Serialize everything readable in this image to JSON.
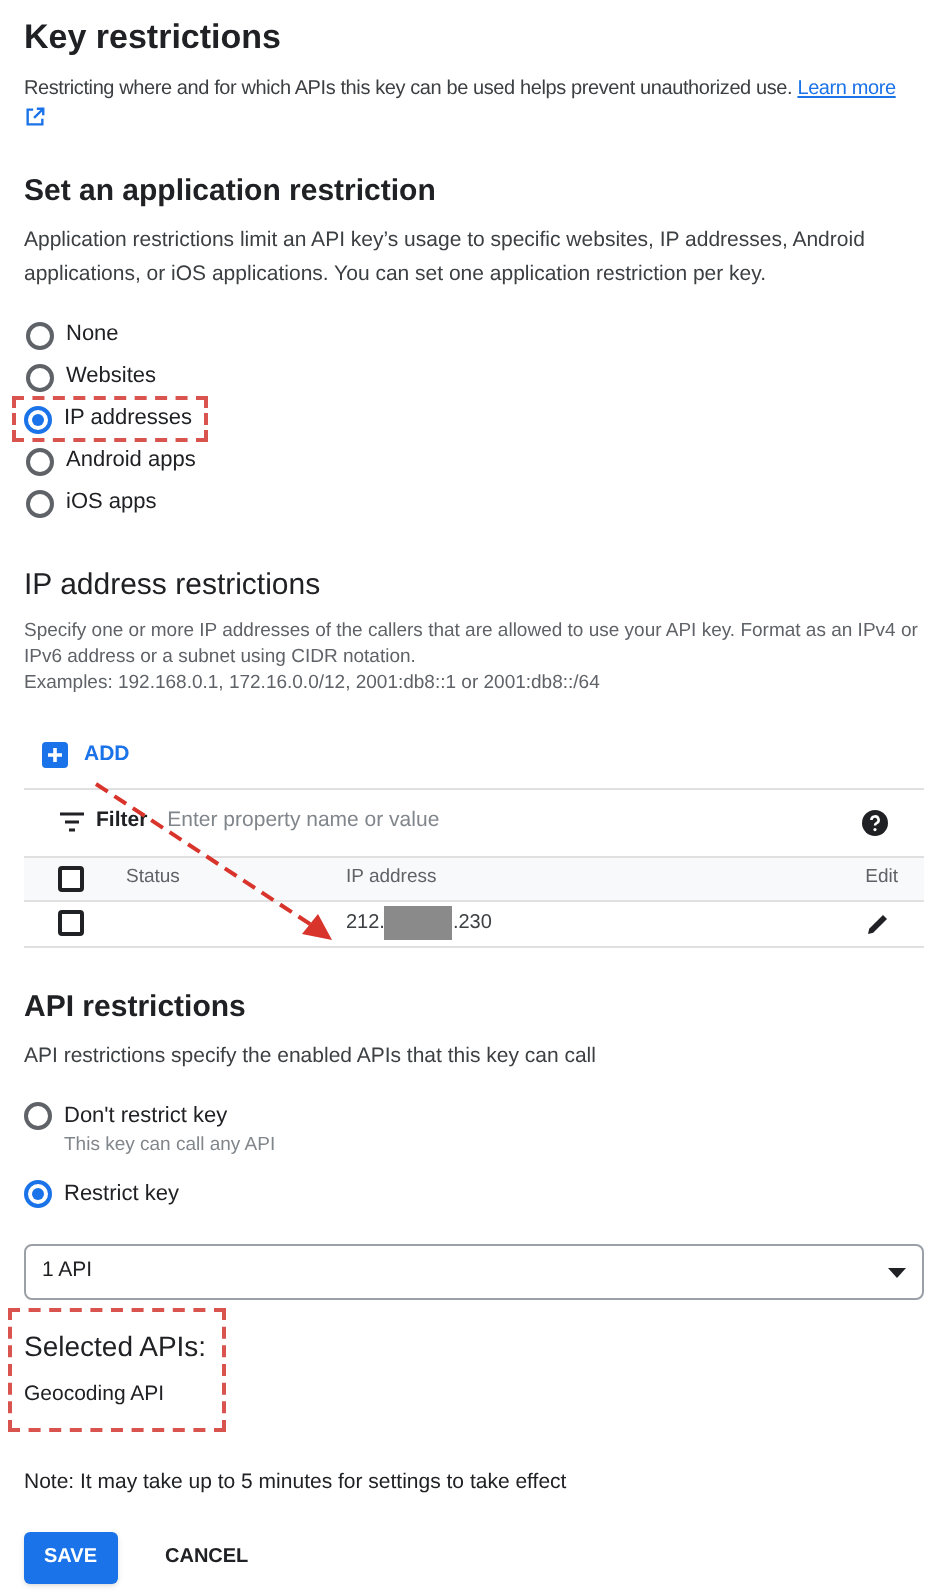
{
  "key_restrictions": {
    "title": "Key restrictions",
    "description": "Restricting where and for which APIs this key can be used helps prevent unauthorized use.",
    "link": "Learn more"
  },
  "application_restriction": {
    "title": "Set an application restriction",
    "description": "Application restrictions limit an API key’s usage to specific websites, IP addresses, Android applications, or iOS applications. You can set one application restriction per key.",
    "options": [
      {
        "label": "None",
        "selected": false,
        "highlighted": false
      },
      {
        "label": "Websites",
        "selected": false,
        "highlighted": false
      },
      {
        "label": "IP addresses",
        "selected": true,
        "highlighted": true
      },
      {
        "label": "Android apps",
        "selected": false,
        "highlighted": false
      },
      {
        "label": "iOS apps",
        "selected": false,
        "highlighted": false
      }
    ]
  },
  "ip_restrictions": {
    "title": "IP address restrictions",
    "description": [
      "Specify one or more IP addresses of the callers that are allowed to use your API key. Format as an IPv4 or IPv6 address or a subnet using CIDR notation.",
      "Examples: 192.168.0.1, 172.16.0.0/12, 2001:db8::1 or 2001:db8::/64"
    ],
    "add_button": "ADD",
    "filter": {
      "label": "Filter",
      "placeholder": "Enter property name or value"
    },
    "table": {
      "columns": [
        "Status",
        "IP address",
        "Edit"
      ],
      "rows": [
        {
          "checked": false,
          "status": "",
          "ip_prefix": "212.",
          "ip_suffix": ".230",
          "redacted": true
        }
      ],
      "header_checked": false
    }
  },
  "api_restrictions": {
    "title": "API restrictions",
    "description": "API restrictions specify the enabled APIs that this key can call",
    "options": [
      {
        "label": "Don't restrict key",
        "hint": "This key can call any API",
        "selected": false
      },
      {
        "label": "Restrict key",
        "selected": true
      }
    ],
    "dropdown": {
      "value": "1 API"
    },
    "selected_apis": {
      "title": "Selected APIs:",
      "items": [
        "Geocoding API"
      ],
      "highlighted": true
    }
  },
  "note": "Note: It may take up to 5 minutes for settings to take effect",
  "buttons": [
    {
      "label": "SAVE",
      "kind": "primary"
    },
    {
      "label": "CANCEL",
      "kind": "text"
    }
  ]
}
